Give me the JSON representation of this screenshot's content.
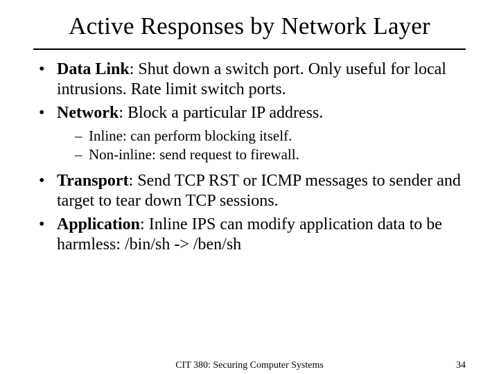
{
  "title": "Active Responses by Network Layer",
  "bullets": {
    "b1_label": "Data Link",
    "b1_text": ": Shut down a switch port.  Only useful for local intrusions.  Rate limit switch ports.",
    "b2_label": "Network",
    "b2_text": ": Block a particular IP address.",
    "b2_sub1": "Inline: can perform blocking itself.",
    "b2_sub2": "Non-inline: send request to firewall.",
    "b3_label": "Transport",
    "b3_text": ": Send TCP RST or ICMP messages to sender and target to tear down TCP sessions.",
    "b4_label": "Application",
    "b4_text": ": Inline IPS can modify application data to be harmless: /bin/sh -> /ben/sh"
  },
  "footer": {
    "course": "CIT 380: Securing Computer Systems",
    "page": "34"
  }
}
